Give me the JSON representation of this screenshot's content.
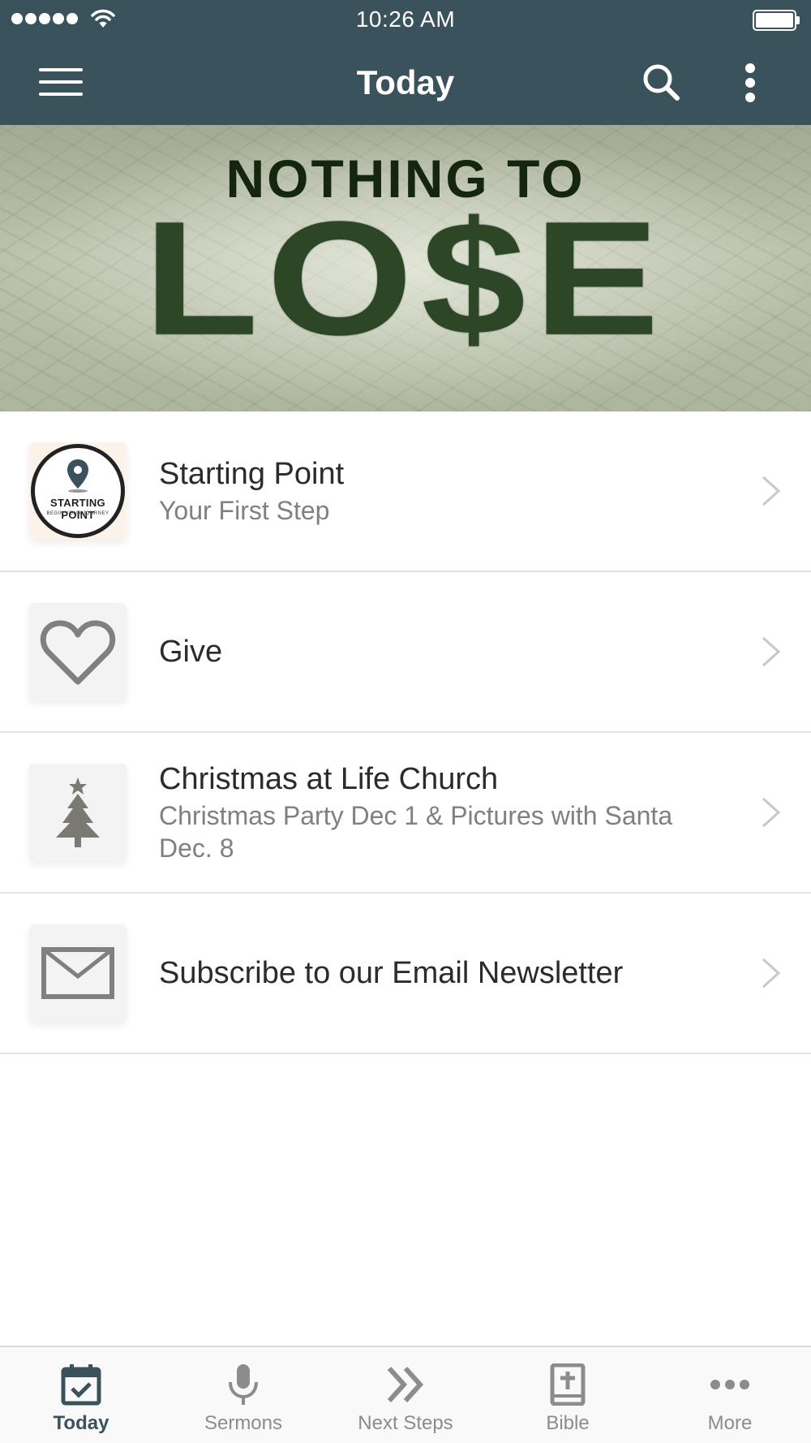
{
  "status_bar": {
    "time": "10:26 AM",
    "signal_icon": "signal-dots-icon",
    "wifi_icon": "wifi-icon",
    "battery_icon": "battery-full-icon"
  },
  "nav": {
    "title": "Today",
    "menu_icon": "hamburger-menu-icon",
    "search_icon": "search-icon",
    "more_icon": "vertical-ellipsis-icon",
    "background_color": "#3a525c"
  },
  "banner": {
    "line1": "NOTHING TO",
    "line2": "LO$E"
  },
  "list": {
    "items": [
      {
        "title": "Starting Point",
        "subtitle": "Your First Step",
        "icon": "starting-point-logo",
        "logo_text": "STARTING POINT",
        "logo_subtext": "BEGIN YOUR JOURNEY"
      },
      {
        "title": "Give",
        "subtitle": "",
        "icon": "heart-icon"
      },
      {
        "title": "Christmas at Life Church",
        "subtitle": "Christmas Party Dec 1 & Pictures with Santa Dec. 8",
        "icon": "christmas-tree-icon"
      },
      {
        "title": "Subscribe to our Email Newsletter",
        "subtitle": "",
        "icon": "envelope-icon"
      }
    ]
  },
  "tabbar": {
    "tabs": [
      {
        "label": "Today",
        "icon": "calendar-check-icon",
        "active": true
      },
      {
        "label": "Sermons",
        "icon": "microphone-icon",
        "active": false
      },
      {
        "label": "Next Steps",
        "icon": "double-chevron-right-icon",
        "active": false
      },
      {
        "label": "Bible",
        "icon": "bible-book-icon",
        "active": false
      },
      {
        "label": "More",
        "icon": "horizontal-ellipsis-icon",
        "active": false
      }
    ],
    "active_color": "#3a525c",
    "inactive_color": "#8c8c8c"
  }
}
